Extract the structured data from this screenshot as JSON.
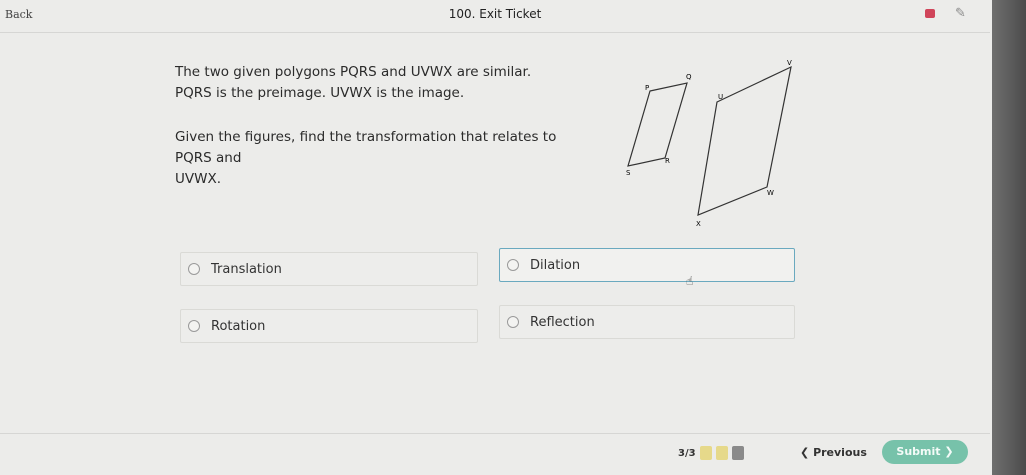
{
  "header": {
    "back_label": "Back",
    "title": "100. Exit Ticket",
    "flag_icon": "flag-icon",
    "pencil_icon": "pencil-icon"
  },
  "question": {
    "line1": "The two given polygons PQRS and UVWX are similar.",
    "line2": "PQRS is the preimage. UVWX is the image.",
    "line3": "Given the figures, find the transformation that relates to PQRS and",
    "line4": "UVWX."
  },
  "figure": {
    "labels": {
      "p": "P",
      "q": "Q",
      "r": "R",
      "s": "S",
      "u": "U",
      "v": "V",
      "w": "W",
      "x": "X"
    }
  },
  "choices": [
    {
      "label": "Translation",
      "selected": false
    },
    {
      "label": "Dilation",
      "selected": true
    },
    {
      "label": "Rotation",
      "selected": false
    },
    {
      "label": "Reflection",
      "selected": false
    }
  ],
  "footer": {
    "progress": "3/3",
    "progress_colors": [
      "#e6d98a",
      "#e6d98a",
      "#8a8a8a"
    ],
    "previous_label": "Previous",
    "submit_label": "Submit"
  },
  "colors": {
    "accent_border": "#6aa9bf",
    "submit_bg": "#77c2aa",
    "flag": "#d0455a"
  }
}
